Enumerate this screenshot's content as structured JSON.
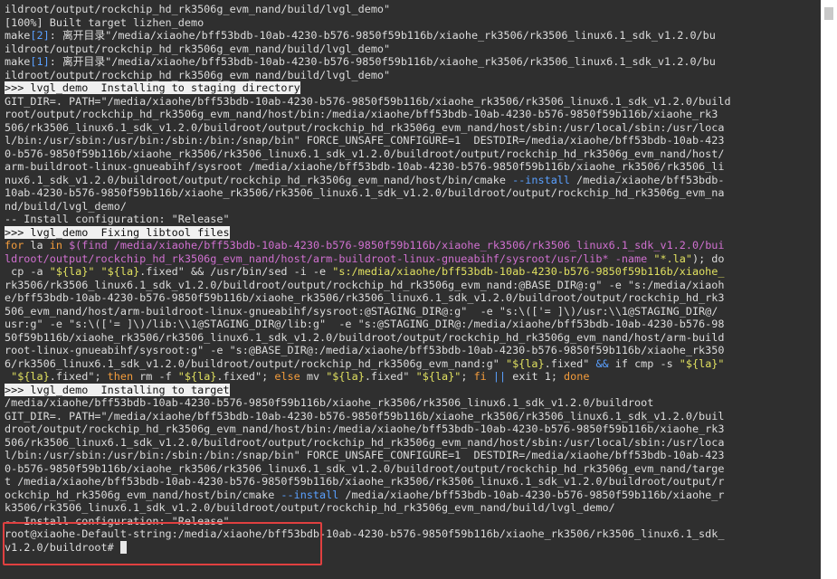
{
  "terminal": {
    "lines": [
      [
        {
          "t": "ildroot/output/rockchip_hd_rk3506g_evm_nand/build/lvgl_demo\""
        }
      ],
      [
        {
          "t": "[100%] Built target lizhen_demo"
        }
      ],
      [
        {
          "t": "make"
        },
        {
          "t": "[2]",
          "c": "blue"
        },
        {
          "t": ": 离开目录\"/media/xiaohe/bff53bdb-10ab-4230-b576-9850f59b116b/xiaohe_rk3506/rk3506_linux6.1_sdk_v1.2.0/bu"
        }
      ],
      [
        {
          "t": "ildroot/output/rockchip_hd_rk3506g_evm_nand/build/lvgl_demo\""
        }
      ],
      [
        {
          "t": "make"
        },
        {
          "t": "[1]",
          "c": "blue"
        },
        {
          "t": ": 离开目录\"/media/xiaohe/bff53bdb-10ab-4230-b576-9850f59b116b/xiaohe_rk3506/rk3506_linux6.1_sdk_v1.2.0/bu"
        }
      ],
      [
        {
          "t": "ildroot/output/rockchip_hd_rk3506g_evm_nand/build/lvgl_demo\""
        }
      ],
      [
        {
          "t": ">>> lvgl_demo  Installing to staging directory",
          "c": "hdr"
        }
      ],
      [
        {
          "t": "GIT_DIR=. PATH=\"/media/xiaohe/bff53bdb-10ab-4230-b576-9850f59b116b/xiaohe_rk3506/rk3506_linux6.1_sdk_v1.2.0/build"
        }
      ],
      [
        {
          "t": "root/output/rockchip_hd_rk3506g_evm_nand/host/bin:/media/xiaohe/bff53bdb-10ab-4230-b576-9850f59b116b/xiaohe_rk3"
        }
      ],
      [
        {
          "t": "506/rk3506_linux6.1_sdk_v1.2.0/buildroot/output/rockchip_hd_rk3506g_evm_nand/host/sbin:/usr/local/sbin:/usr/loca"
        }
      ],
      [
        {
          "t": "l/bin:/usr/sbin:/usr/bin:/sbin:/bin:/snap/bin\" FORCE_UNSAFE_CONFIGURE=1  DESTDIR=/media/xiaohe/bff53bdb-10ab-423"
        }
      ],
      [
        {
          "t": "0-b576-9850f59b116b/xiaohe_rk3506/rk3506_linux6.1_sdk_v1.2.0/buildroot/output/rockchip_hd_rk3506g_evm_nand/host/"
        }
      ],
      [
        {
          "t": "arm-buildroot-linux-gnueabihf/sysroot /media/xiaohe/bff53bdb-10ab-4230-b576-9850f59b116b/xiaohe_rk3506/rk3506_li"
        }
      ],
      [
        {
          "t": "nux6.1_sdk_v1.2.0/buildroot/output/rockchip_hd_rk3506g_evm_nand/host/bin/cmake "
        },
        {
          "t": "--install",
          "c": "blue"
        },
        {
          "t": " /media/xiaohe/bff53bdb-"
        }
      ],
      [
        {
          "t": "10ab-4230-b576-9850f59b116b/xiaohe_rk3506/rk3506_linux6.1_sdk_v1.2.0/buildroot/output/rockchip_hd_rk3506g_evm_na"
        }
      ],
      [
        {
          "t": "nd/build/lvgl_demo/"
        }
      ],
      [
        {
          "t": "-- Install configuration: \"Release\""
        }
      ],
      [
        {
          "t": ">>> lvgl_demo  Fixing libtool files",
          "c": "hdr"
        }
      ],
      [
        {
          "t": "for",
          "c": "kw"
        },
        {
          "t": " la "
        },
        {
          "t": "in",
          "c": "kw"
        },
        {
          "t": " "
        },
        {
          "t": "$(find /media/xiaohe/bff53bdb-10ab-4230-b576-9850f59b116b/xiaohe_rk3506/rk3506_linux6.1_sdk_v1.2.0/bui",
          "c": "mag"
        }
      ],
      [
        {
          "t": "ldroot/output/rockchip_hd_rk3506g_evm_nand/host/arm-buildroot-linux-gnueabihf/sysroot/usr/lib* -name ",
          "c": "mag"
        },
        {
          "t": "\"*.la\"",
          "c": "str"
        },
        {
          "t": "); do"
        }
      ],
      [
        {
          "t": " cp -a "
        },
        {
          "t": "\"${la}\"",
          "c": "str"
        },
        {
          "t": " "
        },
        {
          "t": "\"${la}",
          "c": "str"
        },
        {
          "t": ".fixed\" && /usr/bin/sed -i -e "
        },
        {
          "t": "\"s:/media/xiaohe/bff53bdb-10ab-4230-b576-9850f59b116b/xiaohe_",
          "c": "str"
        }
      ],
      [
        {
          "t": "rk3506/rk3506_linux6.1_sdk_v1.2.0/buildroot/output/rockchip_hd_rk3506g_evm_nand:@BASE_DIR@:g\" -e \"s:/media/xiaoh"
        }
      ],
      [
        {
          "t": "e/bff53bdb-10ab-4230-b576-9850f59b116b/xiaohe_rk3506/rk3506_linux6.1_sdk_v1.2.0/buildroot/output/rockchip_hd_rk3"
        }
      ],
      [
        {
          "t": "506_evm_nand/host/arm-buildroot-linux-gnueabihf/sysroot:@STAGING_DIR@:g\"  -e \"s:\\(['= ]\\)/usr:\\\\1@STAGING_DIR@/"
        }
      ],
      [
        {
          "t": "usr:g\" -e \"s:\\(['= ]\\)/lib:\\\\1@STAGING_DIR@/lib:g\"  -e \"s:@STAGING_DIR@:/media/xiaohe/bff53bdb-10ab-4230-b576-98"
        }
      ],
      [
        {
          "t": "50f59b116b/xiaohe_rk3506/rk3506_linux6.1_sdk_v1.2.0/buildroot/output/rockchip_hd_rk3506g_evm_nand/host/arm-build"
        }
      ],
      [
        {
          "t": "root-linux-gnueabihf/sysroot:g\" -e \"s:@BASE_DIR@:/media/xiaohe/bff53bdb-10ab-4230-b576-9850f59b116b/xiaohe_rk350"
        }
      ],
      [
        {
          "t": "6/rk3506_linux6.1_sdk_v1.2.0/buildroot/output/rockchip_hd_rk3506g_evm_nand:g\" "
        },
        {
          "t": "\"${la}",
          "c": "str"
        },
        {
          "t": ".fixed\" "
        },
        {
          "t": "&&",
          "c": "blue"
        },
        {
          "t": " if cmp -s "
        },
        {
          "t": "\"${la}\"",
          "c": "str"
        }
      ],
      [
        {
          "t": " "
        },
        {
          "t": "\"${la}",
          "c": "str"
        },
        {
          "t": ".fixed\"; "
        },
        {
          "t": "then",
          "c": "kw"
        },
        {
          "t": " rm -f "
        },
        {
          "t": "\"${la}",
          "c": "str"
        },
        {
          "t": ".fixed\"; "
        },
        {
          "t": "else",
          "c": "kw"
        },
        {
          "t": " mv "
        },
        {
          "t": "\"${la}",
          "c": "str"
        },
        {
          "t": ".fixed\" "
        },
        {
          "t": "\"${la}\"",
          "c": "str"
        },
        {
          "t": "; "
        },
        {
          "t": "fi",
          "c": "kw"
        },
        {
          "t": " "
        },
        {
          "t": "||",
          "c": "blue"
        },
        {
          "t": " exit 1; "
        },
        {
          "t": "done",
          "c": "kw"
        }
      ],
      [
        {
          "t": ">>> lvgl_demo  Installing to target",
          "c": "hdr"
        }
      ],
      [
        {
          "t": "/media/xiaohe/bff53bdb-10ab-4230-b576-9850f59b116b/xiaohe_rk3506/rk3506_linux6.1_sdk_v1.2.0/buildroot"
        }
      ],
      [
        {
          "t": "GIT_DIR=. PATH=\"/media/xiaohe/bff53bdb-10ab-4230-b576-9850f59b116b/xiaohe_rk3506/rk3506_linux6.1_sdk_v1.2.0/buil"
        }
      ],
      [
        {
          "t": "droot/output/rockchip_hd_rk3506g_evm_nand/host/bin:/media/xiaohe/bff53bdb-10ab-4230-b576-9850f59b116b/xiaohe_rk3"
        }
      ],
      [
        {
          "t": "506/rk3506_linux6.1_sdk_v1.2.0/buildroot/output/rockchip_hd_rk3506g_evm_nand/host/sbin:/usr/local/sbin:/usr/loca"
        }
      ],
      [
        {
          "t": "l/bin:/usr/sbin:/usr/bin:/sbin:/bin:/snap/bin\" FORCE_UNSAFE_CONFIGURE=1  DESTDIR=/media/xiaohe/bff53bdb-10ab-423"
        }
      ],
      [
        {
          "t": "0-b576-9850f59b116b/xiaohe_rk3506/rk3506_linux6.1_sdk_v1.2.0/buildroot/output/rockchip_hd_rk3506g_evm_nand/targe"
        }
      ],
      [
        {
          "t": "t /media/xiaohe/bff53bdb-10ab-4230-b576-9850f59b116b/xiaohe_rk3506/rk3506_linux6.1_sdk_v1.2.0/buildroot/output/r"
        }
      ],
      [
        {
          "t": "ockchip_hd_rk3506g_evm_nand/host/bin/cmake "
        },
        {
          "t": "--install",
          "c": "blue"
        },
        {
          "t": " /media/xiaohe/bff53bdb-10ab-4230-b576-9850f59b116b/xiaohe_r"
        }
      ],
      [
        {
          "t": "k3506/rk3506_linux6.1_sdk_v1.2.0/buildroot/output/rockchip_hd_rk3506g_evm_nand/build/lvgl_demo/"
        }
      ],
      [
        {
          "t": "-- Install configuration: \"Release\""
        }
      ],
      [
        {
          "t": "root@xiaohe-Default-string:/media/xiaohe/bff53bdb-10ab-4230-b576-9850f59b116b/xiaohe_rk3506/rk3506_linux6.1_sdk_"
        }
      ],
      [
        {
          "t": "v1.2.0/buildroot# "
        },
        {
          "t": " ",
          "c": "cursor"
        }
      ]
    ]
  },
  "colors": {
    "background": "#2f2f2f",
    "text": "#dcdcdc",
    "keyword": "#f39c3c",
    "string": "#e0e060",
    "highlight_box": "#e04040"
  }
}
